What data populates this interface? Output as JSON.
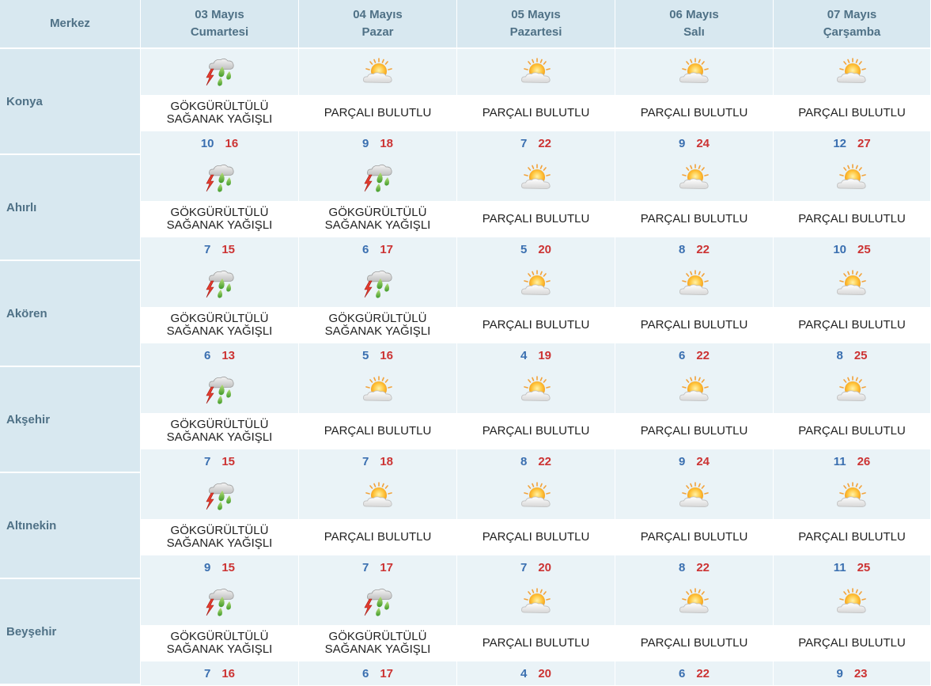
{
  "header": {
    "center_label": "Merkez",
    "days": [
      {
        "date": "03 Mayıs",
        "weekday": "Cumartesi"
      },
      {
        "date": "04 Mayıs",
        "weekday": "Pazar"
      },
      {
        "date": "05 Mayıs",
        "weekday": "Pazartesi"
      },
      {
        "date": "06 Mayıs",
        "weekday": "Salı"
      },
      {
        "date": "07 Mayıs",
        "weekday": "Çarşamba"
      }
    ]
  },
  "rows": [
    {
      "city": "Konya",
      "days": [
        {
          "icon": "thunderstorm-rain-icon",
          "desc": "GÖKGÜRÜLTÜLÜ\nSAĞANAK YAĞIŞLI",
          "min": "10",
          "max": "16"
        },
        {
          "icon": "partly-cloudy-icon",
          "desc": "PARÇALI BULUTLU",
          "min": "9",
          "max": "18"
        },
        {
          "icon": "partly-cloudy-icon",
          "desc": "PARÇALI BULUTLU",
          "min": "7",
          "max": "22"
        },
        {
          "icon": "partly-cloudy-icon",
          "desc": "PARÇALI BULUTLU",
          "min": "9",
          "max": "24"
        },
        {
          "icon": "partly-cloudy-icon",
          "desc": "PARÇALI BULUTLU",
          "min": "12",
          "max": "27"
        }
      ]
    },
    {
      "city": "Ahırlı",
      "days": [
        {
          "icon": "thunderstorm-rain-icon",
          "desc": "GÖKGÜRÜLTÜLÜ\nSAĞANAK YAĞIŞLI",
          "min": "7",
          "max": "15"
        },
        {
          "icon": "thunderstorm-rain-icon",
          "desc": "GÖKGÜRÜLTÜLÜ\nSAĞANAK YAĞIŞLI",
          "min": "6",
          "max": "17"
        },
        {
          "icon": "partly-cloudy-icon",
          "desc": "PARÇALI BULUTLU",
          "min": "5",
          "max": "20"
        },
        {
          "icon": "partly-cloudy-icon",
          "desc": "PARÇALI BULUTLU",
          "min": "8",
          "max": "22"
        },
        {
          "icon": "partly-cloudy-icon",
          "desc": "PARÇALI BULUTLU",
          "min": "10",
          "max": "25"
        }
      ]
    },
    {
      "city": "Akören",
      "days": [
        {
          "icon": "thunderstorm-rain-icon",
          "desc": "GÖKGÜRÜLTÜLÜ\nSAĞANAK YAĞIŞLI",
          "min": "6",
          "max": "13"
        },
        {
          "icon": "thunderstorm-rain-icon",
          "desc": "GÖKGÜRÜLTÜLÜ\nSAĞANAK YAĞIŞLI",
          "min": "5",
          "max": "16"
        },
        {
          "icon": "partly-cloudy-icon",
          "desc": "PARÇALI BULUTLU",
          "min": "4",
          "max": "19"
        },
        {
          "icon": "partly-cloudy-icon",
          "desc": "PARÇALI BULUTLU",
          "min": "6",
          "max": "22"
        },
        {
          "icon": "partly-cloudy-icon",
          "desc": "PARÇALI BULUTLU",
          "min": "8",
          "max": "25"
        }
      ]
    },
    {
      "city": "Akşehir",
      "days": [
        {
          "icon": "thunderstorm-rain-icon",
          "desc": "GÖKGÜRÜLTÜLÜ\nSAĞANAK YAĞIŞLI",
          "min": "7",
          "max": "15"
        },
        {
          "icon": "partly-cloudy-icon",
          "desc": "PARÇALI BULUTLU",
          "min": "7",
          "max": "18"
        },
        {
          "icon": "partly-cloudy-icon",
          "desc": "PARÇALI BULUTLU",
          "min": "8",
          "max": "22"
        },
        {
          "icon": "partly-cloudy-icon",
          "desc": "PARÇALI BULUTLU",
          "min": "9",
          "max": "24"
        },
        {
          "icon": "partly-cloudy-icon",
          "desc": "PARÇALI BULUTLU",
          "min": "11",
          "max": "26"
        }
      ]
    },
    {
      "city": "Altınekin",
      "days": [
        {
          "icon": "thunderstorm-rain-icon",
          "desc": "GÖKGÜRÜLTÜLÜ\nSAĞANAK YAĞIŞLI",
          "min": "9",
          "max": "15"
        },
        {
          "icon": "partly-cloudy-icon",
          "desc": "PARÇALI BULUTLU",
          "min": "7",
          "max": "17"
        },
        {
          "icon": "partly-cloudy-icon",
          "desc": "PARÇALI BULUTLU",
          "min": "7",
          "max": "20"
        },
        {
          "icon": "partly-cloudy-icon",
          "desc": "PARÇALI BULUTLU",
          "min": "8",
          "max": "22"
        },
        {
          "icon": "partly-cloudy-icon",
          "desc": "PARÇALI BULUTLU",
          "min": "11",
          "max": "25"
        }
      ]
    },
    {
      "city": "Beyşehir",
      "days": [
        {
          "icon": "thunderstorm-rain-icon",
          "desc": "GÖKGÜRÜLTÜLÜ\nSAĞANAK YAĞIŞLI",
          "min": "7",
          "max": "16"
        },
        {
          "icon": "thunderstorm-rain-icon",
          "desc": "GÖKGÜRÜLTÜLÜ\nSAĞANAK YAĞIŞLI",
          "min": "6",
          "max": "17"
        },
        {
          "icon": "partly-cloudy-icon",
          "desc": "PARÇALI BULUTLU",
          "min": "4",
          "max": "20"
        },
        {
          "icon": "partly-cloudy-icon",
          "desc": "PARÇALI BULUTLU",
          "min": "6",
          "max": "22"
        },
        {
          "icon": "partly-cloudy-icon",
          "desc": "PARÇALI BULUTLU",
          "min": "9",
          "max": "23"
        }
      ]
    }
  ],
  "colors": {
    "header_bg": "#d8e8f0",
    "header_text": "#4f7186",
    "row_band": "#eaf3f7",
    "min_temp": "#3a6fb0",
    "max_temp": "#cc3333"
  }
}
